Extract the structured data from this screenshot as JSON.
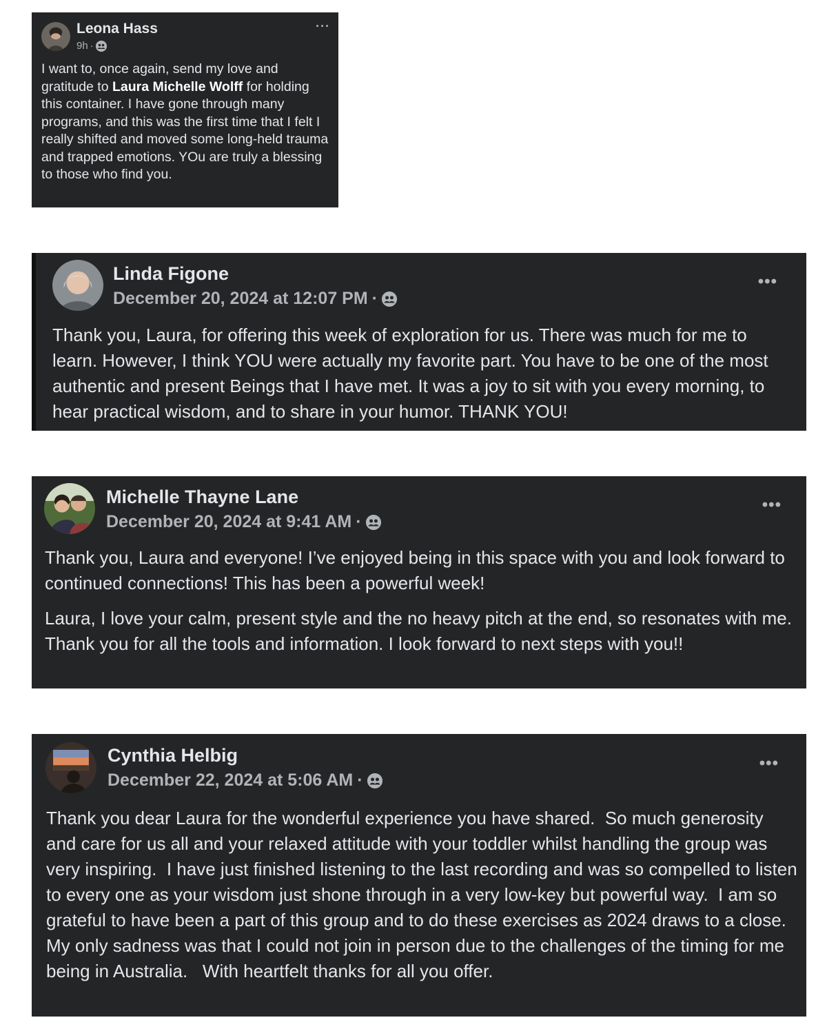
{
  "posts": [
    {
      "author": "Leona Hass",
      "time": "9h",
      "separator": "·",
      "more": "···",
      "body_parts": [
        "I want to, once again, send my love and gratitude to ",
        "Laura Michelle Wolff",
        " for holding this container. I have gone through many programs, and this was the first time that I felt I really shifted and moved some long-held trauma and trapped emotions. YOu are truly a blessing to those who find you."
      ]
    },
    {
      "author": "Linda Figone",
      "time": "December 20, 2024 at 12:07 PM",
      "separator": "·",
      "more": "•••",
      "paragraphs": [
        "Thank you, Laura, for offering this week of exploration for us. There was much for me to learn. However, I think YOU were actually my favorite part. You have to be one of the most authentic and present Beings that I have met. It was a joy to sit with you every morning, to hear practical wisdom, and to share in your humor. THANK YOU!"
      ]
    },
    {
      "author": "Michelle Thayne Lane",
      "time": "December 20, 2024 at 9:41 AM",
      "separator": "·",
      "more": "•••",
      "paragraphs": [
        "Thank you, Laura and everyone! I’ve enjoyed being in this space with you and look forward to continued connections! This has been a powerful week!",
        "Laura, I love your calm, present style and the no heavy pitch at the end, so resonates with me. Thank you for all the tools and information. I look forward to next steps with you!!"
      ]
    },
    {
      "author": "Cynthia Helbig",
      "time": "December 22, 2024 at 5:06 AM",
      "separator": "·",
      "more": "•••",
      "paragraphs": [
        "Thank you dear Laura for the wonderful experience you have shared.  So much generosity and care for us all and your relaxed attitude with your toddler whilst handling the group was very inspiring.  I have just finished listening to the last recording and was so compelled to listen to every one as your wisdom just shone through in a very low-key but powerful way.  I am so grateful to have been a part of this group and to do these exercises as 2024 draws to a close.  My only sadness was that I could not join in person due to the challenges of the timing for me being in Australia.   With heartfelt thanks for all you offer."
      ]
    }
  ],
  "icons": {
    "privacy": "group-privacy-icon",
    "menu": "more-options-icon"
  },
  "colors": {
    "card_bg": "#242526",
    "text": "#e4e6eb",
    "secondary": "#b0b3b8"
  }
}
